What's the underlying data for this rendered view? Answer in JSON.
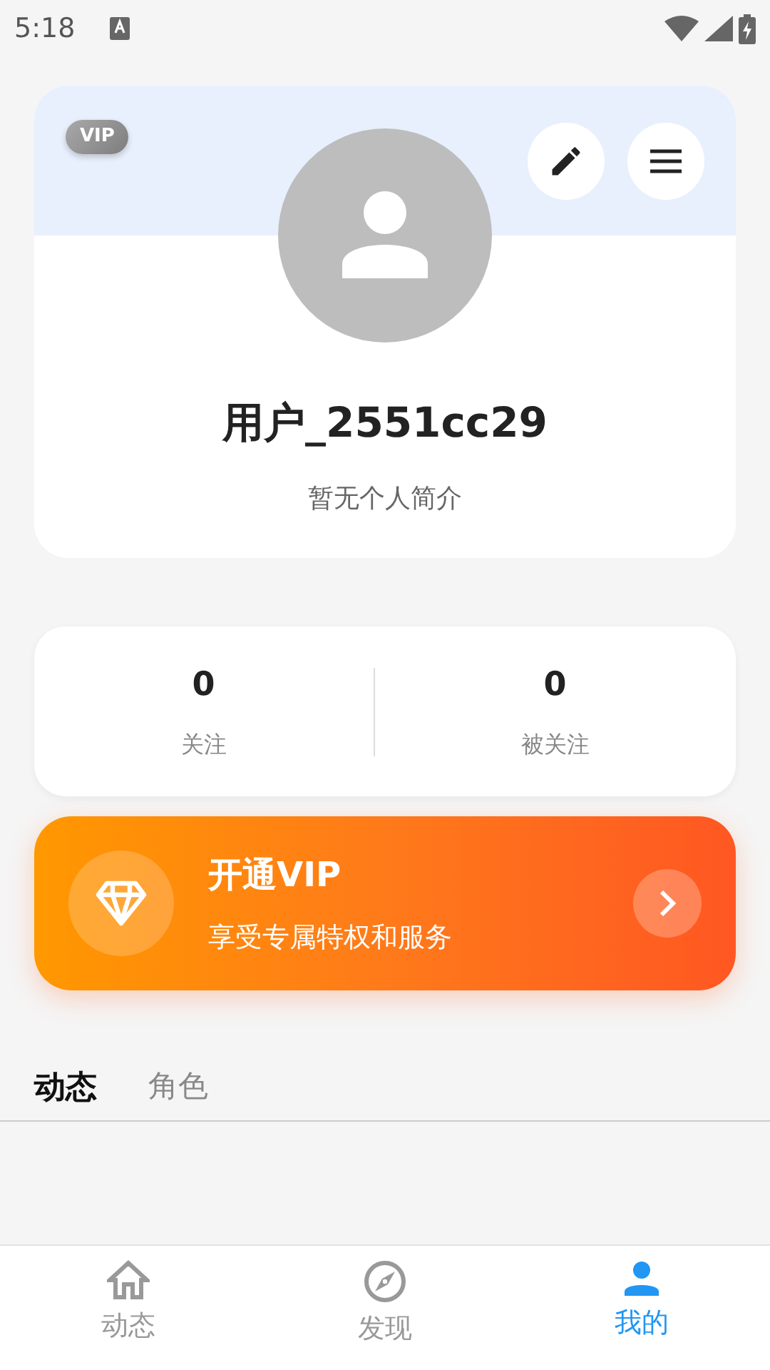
{
  "status_bar": {
    "time": "5:18"
  },
  "profile": {
    "vip_badge": "VIP",
    "username": "用户_2551cc29",
    "bio": "暂无个人简介"
  },
  "stats": [
    {
      "value": "0",
      "label": "关注"
    },
    {
      "value": "0",
      "label": "被关注"
    }
  ],
  "vip_banner": {
    "title": "开通VIP",
    "subtitle": "享受专属特权和服务"
  },
  "tabs": [
    {
      "label": "动态",
      "selected": true
    },
    {
      "label": "角色",
      "selected": false
    }
  ],
  "bottom_nav": [
    {
      "label": "动态",
      "selected": false
    },
    {
      "label": "发现",
      "selected": false
    },
    {
      "label": "我的",
      "selected": true
    }
  ]
}
